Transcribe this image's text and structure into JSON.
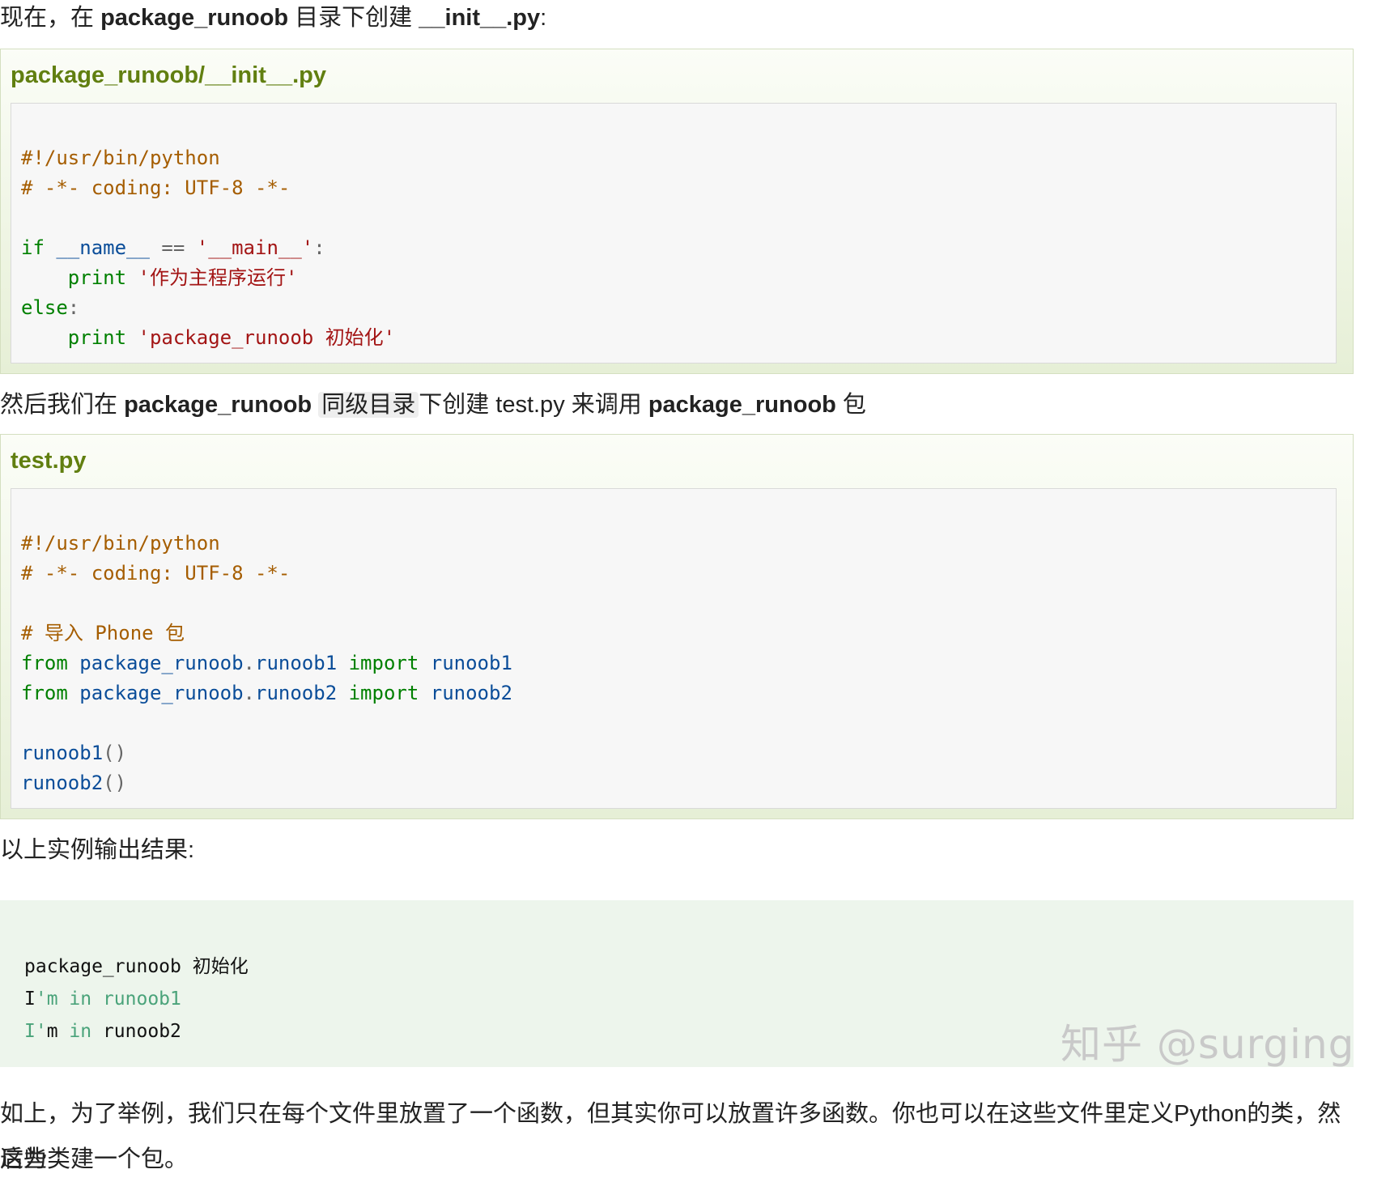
{
  "intro1": {
    "a": "现在，在 ",
    "b": "package_runoob",
    "c": " 目录下创建 ",
    "d": "__init__.py",
    "e": ":"
  },
  "example1": {
    "title": "package_runoob/__init__.py",
    "lines": {
      "l1": "#!/usr/bin/python",
      "l2": "# -*- coding: UTF-8 -*-",
      "l4_kw": "if",
      "l4_id": " __name__ ",
      "l4_op": "==",
      "l4_st": " '__main__'",
      "l4_end": ":",
      "l5_kw": "print",
      "l5_st": "'作为主程序运行'",
      "l6_kw": "else",
      "l6_end": ":",
      "l7_kw": "print",
      "l7_st": "'package_runoob 初始化'"
    }
  },
  "intro2": {
    "a": "然后我们在 ",
    "b": "package_runoob",
    "c": "同级目录",
    "d": "下创建 test.py 来调用 ",
    "e": "package_runoob",
    "f": " 包"
  },
  "example2": {
    "title": "test.py",
    "lines": {
      "l1": "#!/usr/bin/python",
      "l2": "# -*- coding: UTF-8 -*-",
      "l4": "# 导入 Phone 包",
      "l5_kw": "from",
      "l5_id": " package_runoob",
      "l5_op": ".",
      "l5_id2": "runoob1",
      "l5_kw2": " import",
      "l5_id3": " runoob1",
      "l6_kw": "from",
      "l6_id": " package_runoob",
      "l6_op": ".",
      "l6_id2": "runoob2",
      "l6_kw2": " import",
      "l6_id3": " runoob2",
      "l8_id": "runoob1",
      "l8_op": "()",
      "l9_id": "runoob2",
      "l9_op": "()"
    }
  },
  "intro3": "以上实例输出结果:",
  "output": {
    "l1": "package_runoob 初始化",
    "l2_a": "I",
    "l2_b": "'m in runoob1",
    "l3_a": "I'",
    "l3_b": "m ",
    "l3_c": "in",
    "l3_d": " runoob2"
  },
  "conclusion": {
    "l1": "如上，为了举例，我们只在每个文件里放置了一个函数，但其实你可以放置许多函数。你也可以在这些文件里定义Python的类，然后为",
    "l2": "这些类建一个包。"
  },
  "watermark": "知乎 @surging"
}
